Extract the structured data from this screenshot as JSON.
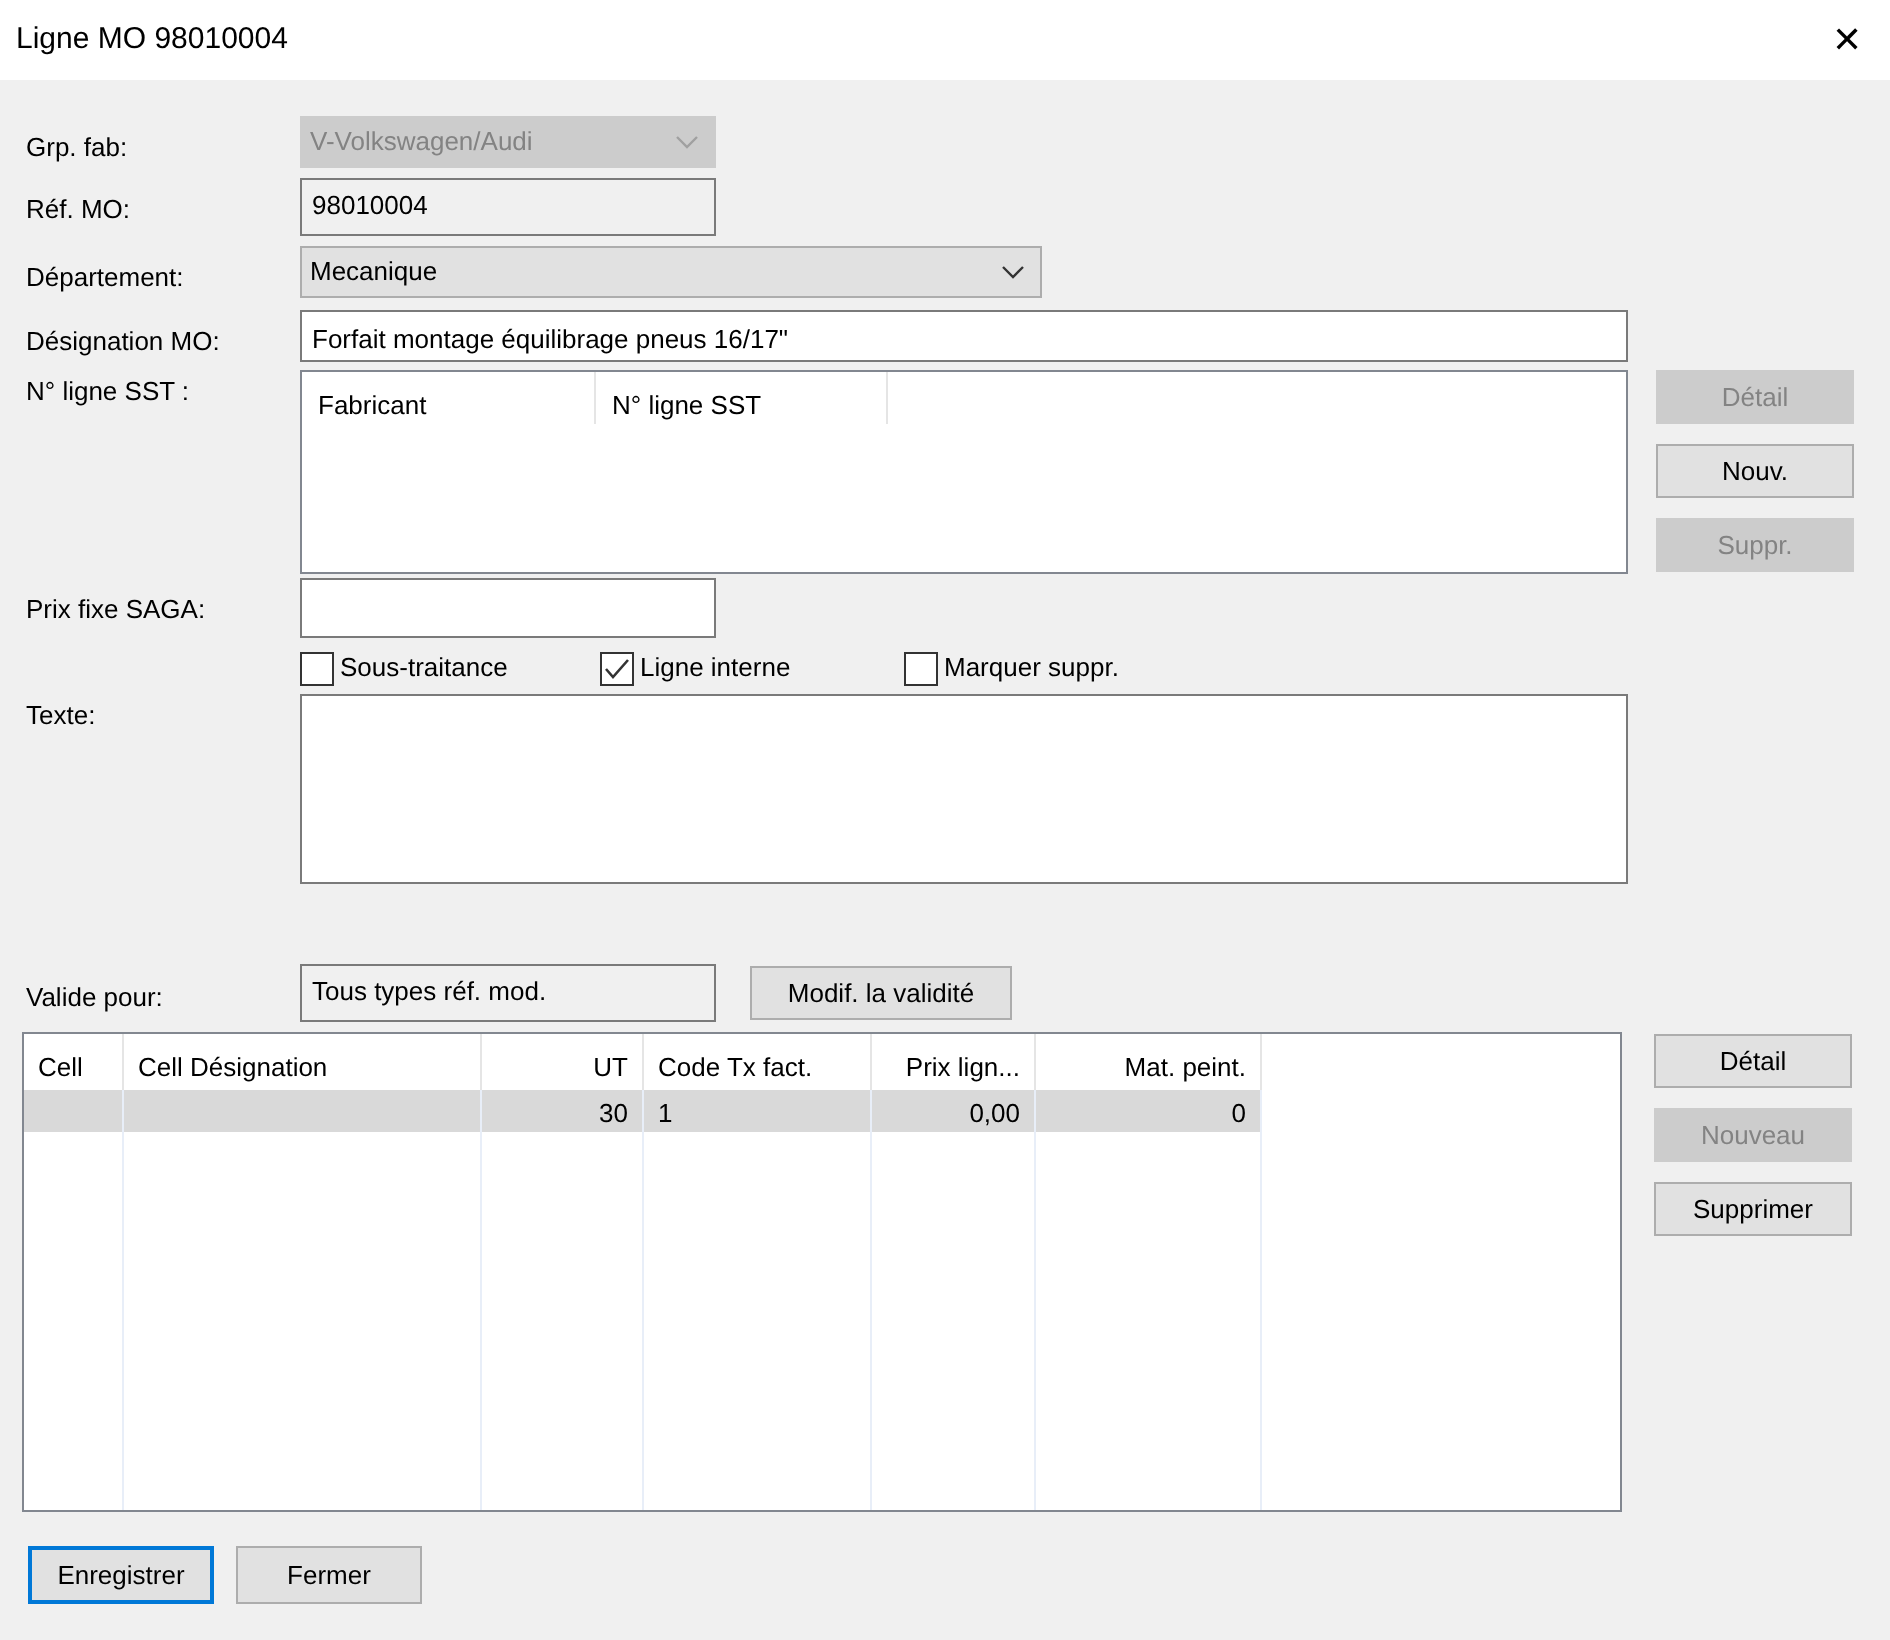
{
  "window": {
    "title": "Ligne MO 98010004",
    "close": "✕"
  },
  "fields": [
    {
      "kind": "select",
      "label": "Grp. fab:",
      "value": "V-Volkswagen/Audi",
      "disabled": true
    },
    {
      "kind": "text",
      "label": "Réf. MO:",
      "value": "98010004",
      "readonly": true
    },
    {
      "kind": "select",
      "label": "Département:",
      "value": "Mecanique",
      "disabled": false
    },
    {
      "kind": "text",
      "label": "Désignation MO:",
      "value": "Forfait montage équilibrage pneus 16/17\"",
      "readonly": false
    }
  ],
  "sst": {
    "label": "N° ligne SST :",
    "columns": [
      "Fabricant",
      "N° ligne SST"
    ],
    "buttons": [
      {
        "label": "Détail",
        "disabled": true
      },
      {
        "label": "Nouv.",
        "disabled": false
      },
      {
        "label": "Suppr.",
        "disabled": true
      }
    ]
  },
  "prix_fixe": {
    "label": "Prix fixe SAGA:"
  },
  "checkboxes": [
    {
      "label": "Sous-traitance",
      "checked": false
    },
    {
      "label": "Ligne interne",
      "checked": true
    },
    {
      "label": "Marquer suppr.",
      "checked": false
    }
  ],
  "texte": {
    "label": "Texte:"
  },
  "validity": {
    "label": "Valide pour:",
    "value": "Tous types réf. mod.",
    "button": "Modif. la validité"
  },
  "grid": {
    "columns": [
      {
        "label": "Cell",
        "kind": "text"
      },
      {
        "label": "Cell Désignation",
        "kind": "text"
      },
      {
        "label": "UT",
        "kind": "number"
      },
      {
        "label": "Code Tx fact.",
        "kind": "text"
      },
      {
        "label": "Prix lign...",
        "kind": "number"
      },
      {
        "label": "Mat. peint.",
        "kind": "number"
      }
    ],
    "rows": [
      {
        "cells": [
          "",
          "",
          "30",
          "1",
          "0,00",
          "0"
        ],
        "selected": true
      }
    ],
    "buttons": [
      {
        "label": "Détail",
        "disabled": false
      },
      {
        "label": "Nouveau",
        "disabled": true
      },
      {
        "label": "Supprimer",
        "disabled": false
      }
    ]
  },
  "footer": [
    {
      "label": "Enregistrer",
      "default": true
    },
    {
      "label": "Fermer",
      "default": false
    }
  ]
}
